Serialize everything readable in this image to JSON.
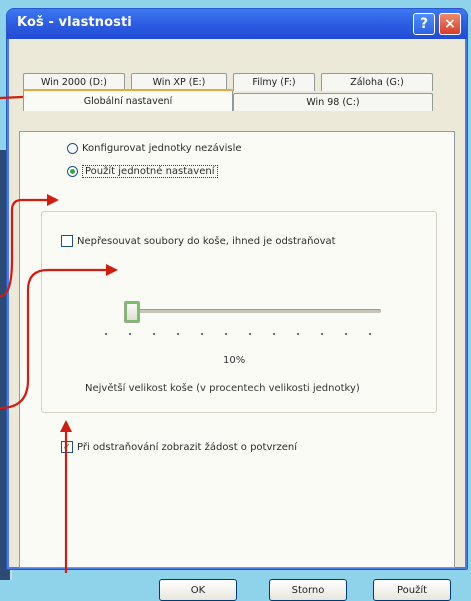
{
  "window": {
    "title": "Koš - vlastnosti",
    "help_button": "?",
    "close_button": "×"
  },
  "tabs": {
    "top_row": [
      {
        "label": "Win 2000 (D:)"
      },
      {
        "label": "Win XP (E:)"
      },
      {
        "label": "Filmy (F:)"
      },
      {
        "label": "Záloha (G:)"
      }
    ],
    "bottom_row": [
      {
        "label": "Globální nastavení",
        "active": true
      },
      {
        "label": "Win 98 (C:)"
      }
    ]
  },
  "options": {
    "radio_independent": "Konfigurovat jednotky nezávisle",
    "radio_unified": "Použít jednotné nastavení",
    "checkbox_no_recycle": "Nepřesouvat soubory do koše, ihned je odstraňovat",
    "slider_percent": "10%",
    "slider_value": 10,
    "size_label": "Největší velikost koše (v procentech velikosti jednotky)",
    "checkbox_confirm": "Při odstraňování zobrazit žádost o potvrzení"
  },
  "buttons": {
    "ok": "OK",
    "cancel": "Storno",
    "apply": "Použít"
  },
  "colors": {
    "background": "#8fd3ea",
    "titlebar": "#2f5fe4",
    "callout": "#d11c10"
  }
}
